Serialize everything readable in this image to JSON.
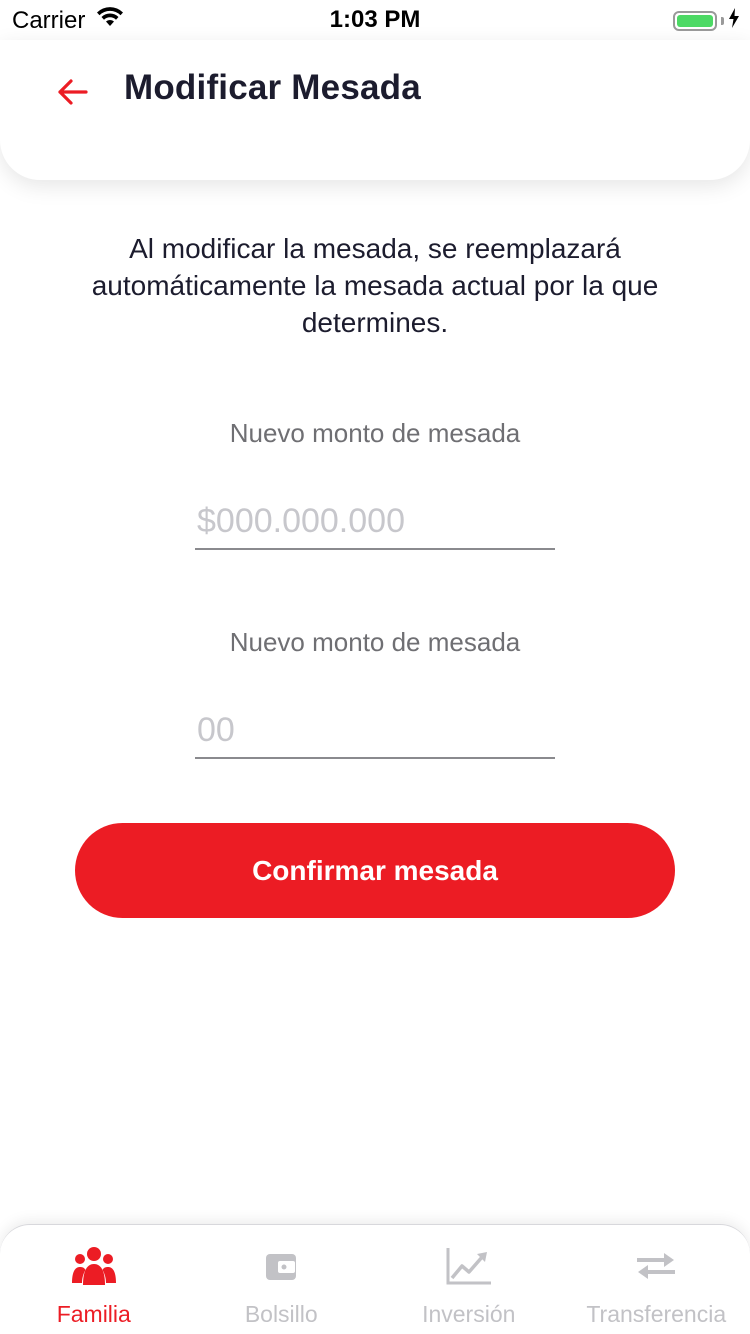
{
  "status_bar": {
    "carrier": "Carrier",
    "time": "1:03 PM",
    "wifi_icon": "wifi-icon",
    "battery_icon": "battery-icon",
    "charging_icon": "charging-bolt-icon"
  },
  "header": {
    "back_icon": "arrow-left-icon",
    "title": "Modificar Mesada"
  },
  "description": "Al modificar la mesada, se reemplazará automáticamente la mesada actual por la que determines.",
  "form": {
    "amount_field": {
      "label": "Nuevo monto de mesada",
      "value": "",
      "placeholder": "$000.000.000"
    },
    "second_field": {
      "label": "Nuevo monto de mesada",
      "value": "",
      "placeholder": "00"
    },
    "confirm_label": "Confirmar mesada"
  },
  "tab_bar": {
    "tabs": [
      {
        "label": "Familia",
        "icon": "family-icon",
        "active": true
      },
      {
        "label": "Bolsillo",
        "icon": "wallet-icon",
        "active": false
      },
      {
        "label": "Inversión",
        "icon": "chart-line-icon",
        "active": false
      },
      {
        "label": "Transferencia",
        "icon": "transfer-arrows-icon",
        "active": false
      }
    ]
  },
  "colors": {
    "accent": "#ec1c24",
    "text_primary": "#1c1c2e",
    "label_gray": "#6f6f73",
    "inactive_tab": "#c2c2c6"
  }
}
